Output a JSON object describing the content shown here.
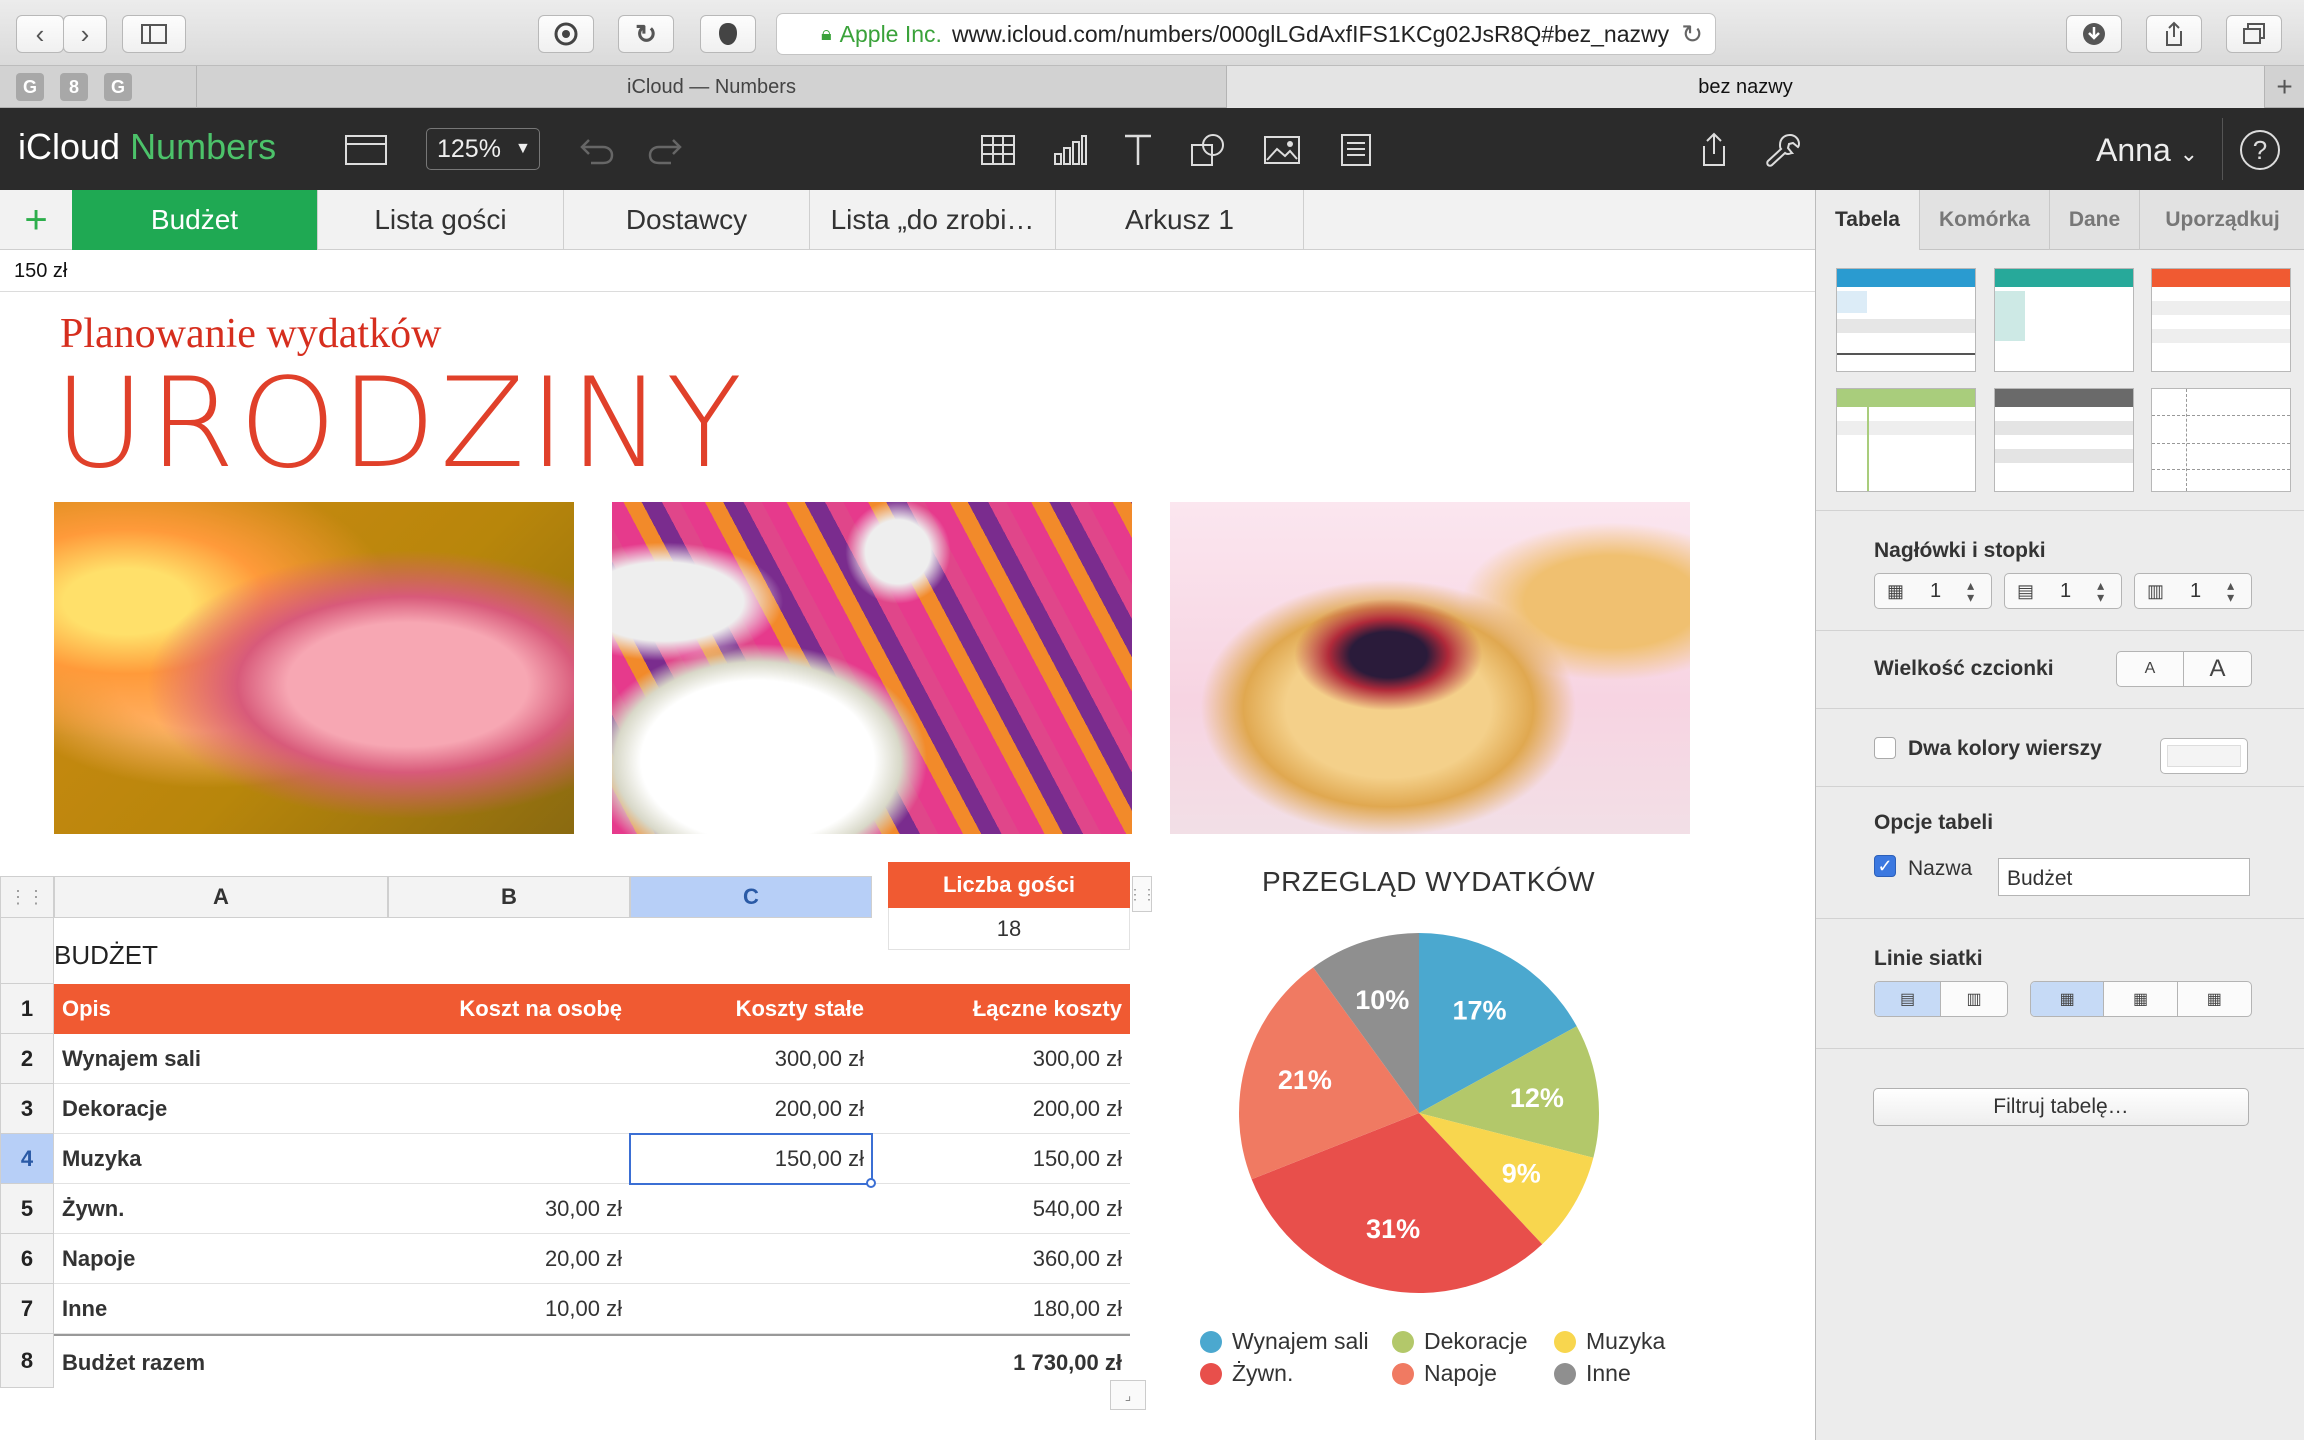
{
  "browser": {
    "url_org": "Apple Inc.",
    "url": "www.icloud.com/numbers/000glLGdAxfIFS1KCg02JsR8Q#bez_nazwy",
    "tabs": [
      "iCloud — Numbers",
      "bez nazwy"
    ],
    "favicons": [
      "G",
      "8",
      "G"
    ]
  },
  "app": {
    "brand_icloud": "iCloud",
    "brand_numbers": "Numbers",
    "zoom": "125%",
    "user": "Anna"
  },
  "sheets": [
    "Budżet",
    "Lista gości",
    "Dostawcy",
    "Lista „do zrobi…",
    "Arkusz 1"
  ],
  "value_bar": "150 zł",
  "doc": {
    "subtitle": "Planowanie wydatków",
    "title": "URODZINY"
  },
  "table": {
    "title": "BUDŻET",
    "columns": [
      "A",
      "B",
      "C"
    ],
    "headers": [
      "Opis",
      "Koszt na osobę",
      "Koszty stałe",
      "Łączne koszty"
    ],
    "rows": [
      {
        "num": "2",
        "a": "Wynajem sali",
        "b": "",
        "c": "300,00 zł",
        "d": "300,00 zł"
      },
      {
        "num": "3",
        "a": "Dekoracje",
        "b": "",
        "c": "200,00 zł",
        "d": "200,00 zł"
      },
      {
        "num": "4",
        "a": "Muzyka",
        "b": "",
        "c": "150,00 zł",
        "d": "150,00 zł"
      },
      {
        "num": "5",
        "a": "Żywn.",
        "b": "30,00 zł",
        "c": "",
        "d": "540,00 zł"
      },
      {
        "num": "6",
        "a": "Napoje",
        "b": "20,00 zł",
        "c": "",
        "d": "360,00 zł"
      },
      {
        "num": "7",
        "a": "Inne",
        "b": "10,00 zł",
        "c": "",
        "d": "180,00 zł"
      }
    ],
    "total": {
      "num": "8",
      "a": "Budżet razem",
      "d": "1 730,00 zł"
    },
    "header_num": "1"
  },
  "guests": {
    "label": "Liczba gości",
    "value": "18"
  },
  "chart_data": {
    "type": "pie",
    "title": "PRZEGLĄD WYDATKÓW",
    "categories": [
      "Wynajem sali",
      "Dekoracje",
      "Muzyka",
      "Żywn.",
      "Napoje",
      "Inne"
    ],
    "values": [
      17,
      12,
      9,
      31,
      21,
      10
    ],
    "labels": [
      "17%",
      "12%",
      "9%",
      "31%",
      "21%",
      "10%"
    ],
    "colors": [
      "#4ba8cf",
      "#b3c86a",
      "#f8d64e",
      "#e84f4b",
      "#f07a62",
      "#8f8f8f"
    ],
    "legend": "bottom"
  },
  "inspector": {
    "tabs": [
      "Tabela",
      "Komórka",
      "Dane",
      "Uporządkuj"
    ],
    "headers_footers": "Nagłówki i stopki",
    "stepper_values": [
      "1",
      "1",
      "1"
    ],
    "font_size": "Wielkość czcionki",
    "font_small": "A",
    "font_large": "A",
    "alternating_rows": "Dwa kolory wierszy",
    "table_options": "Opcje tabeli",
    "name_label": "Nazwa",
    "name_value": "Budżet",
    "gridlines": "Linie siatki",
    "filter_button": "Filtruj tabelę…"
  }
}
